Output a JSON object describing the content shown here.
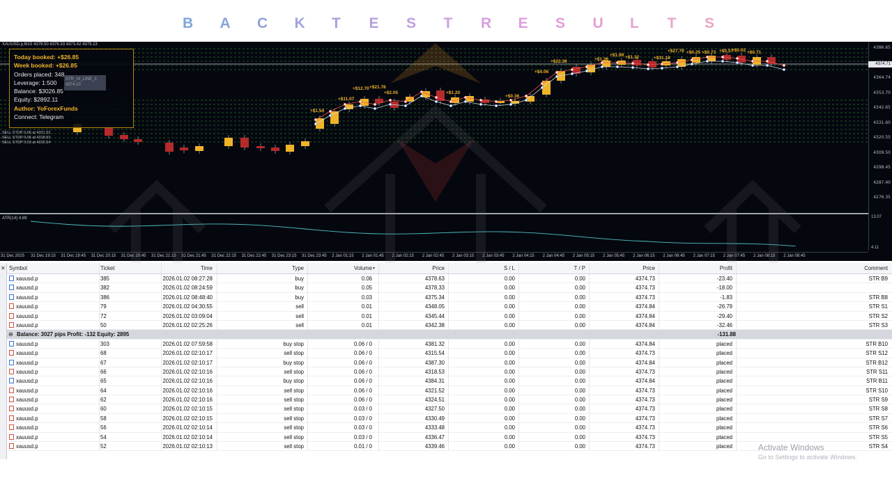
{
  "title": {
    "letters": [
      "B",
      "A",
      "C",
      "K",
      "T",
      "E",
      "S",
      "T",
      "R",
      "E",
      "S",
      "U",
      "L",
      "T",
      "S"
    ],
    "colors": [
      "#7fa6dc",
      "#86a3dc",
      "#93a2dd",
      "#a0a1de",
      "#a9a0df",
      "#b5a1df",
      "#c09fdf",
      "#cb9fdf",
      "#d49fde",
      "#dc9fdc",
      "#e29fd9",
      "#e59fd4",
      "#e7a2cf",
      "#e9a4ca",
      "#eba6c4"
    ]
  },
  "chart": {
    "top_line": "XAUUSD.p,M15  4379.50 4376.33 4373.42 4375.13",
    "info": {
      "today_booked": "Today booked: +$26.85",
      "week_booked": "Week booked: +$26.85",
      "orders_placed": "Orders placed: 348",
      "leverage": "Leverage: 1:500",
      "balance": "Balance: $3026.85",
      "equity": "Equity: $2892.11",
      "author": "Author: YoForexFunds",
      "connect": "Connect: Telegram"
    },
    "tooltip": [
      "STR_UI_LINE_1",
      "4374.10"
    ],
    "stop_labels": [
      "SELL STOP 0.06 at 4321.52",
      "SELL STOP 0.06 at 4318.53",
      "SELL STOP 0.03 at 4315.54"
    ],
    "price_ticks": [
      "4386.65",
      "4375.91",
      "4364.74",
      "4353.70",
      "4342.65",
      "4331.60",
      "4320.55",
      "4309.50",
      "4298.45",
      "4287.40",
      "4276.35"
    ],
    "current_price": "4374.71",
    "atr_label": "ATR(14) 4.89",
    "atr_ticks": [
      "13.07",
      "4.11"
    ],
    "time_ticks": [
      "31 Dec 2025",
      "31 Dec 19:15",
      "31 Dec 19:45",
      "31 Dec 20:15",
      "31 Dec 20:45",
      "31 Dec 21:15",
      "31 Dec 21:45",
      "31 Dec 22:15",
      "31 Dec 22:45",
      "31 Dec 23:15",
      "31 Dec 23:45",
      "2 Jan 01:15",
      "2 Jan 01:45",
      "2 Jan 02:15",
      "2 Jan 02:45",
      "2 Jan 03:15",
      "2 Jan 03:45",
      "2 Jan 04:15",
      "2 Jan 04:45",
      "2 Jan 05:15",
      "2 Jan 05:45",
      "2 Jan 06:15",
      "2 Jan 06:45",
      "2 Jan 07:15",
      "2 Jan 07:45",
      "2 Jan 08:15",
      "2 Jan 08:45"
    ],
    "trade_labels": [
      "+$1.54",
      "+$11.07",
      "+$12.70",
      "+$21.78",
      "+$2.05",
      "+$1.20",
      "+$0.36",
      "+$4.06",
      "+$22.38",
      "+$1.26",
      "+$1.99",
      "+$1.32",
      "+$31.18",
      "+$27.79",
      "+$0.25",
      "+$0.73",
      "+$0.57",
      "+$0.02",
      "+$0.71"
    ]
  },
  "table": {
    "columns": [
      "Symbol",
      "Ticket",
      "Time",
      "Type",
      "Volume",
      "Price",
      "S / L",
      "T / P",
      "Price",
      "Profit",
      "Comment"
    ],
    "positions": [
      {
        "symbol": "xauusd.p",
        "ticket": "385",
        "time": "2026.01.02 08:27:28",
        "type": "buy",
        "volume": "0.06",
        "price": "4378.63",
        "sl": "0.00",
        "tp": "0.00",
        "cur": "4374.73",
        "profit": "-23.40",
        "comment": "STR B9"
      },
      {
        "symbol": "xauusd.p",
        "ticket": "382",
        "time": "2026.01.02 08:24:59",
        "type": "buy",
        "volume": "0.05",
        "price": "4378.33",
        "sl": "0.00",
        "tp": "0.00",
        "cur": "4374.73",
        "profit": "-18.00",
        "comment": ""
      },
      {
        "symbol": "xauusd.p",
        "ticket": "386",
        "time": "2026.01.02 08:48:40",
        "type": "buy",
        "volume": "0.03",
        "price": "4375.34",
        "sl": "0.00",
        "tp": "0.00",
        "cur": "4374.73",
        "profit": "-1.83",
        "comment": "STR B8"
      },
      {
        "symbol": "xauusd.p",
        "ticket": "79",
        "time": "2026.01.02 04:30:55",
        "type": "sell",
        "volume": "0.01",
        "price": "4348.05",
        "sl": "0.00",
        "tp": "0.00",
        "cur": "4374.84",
        "profit": "-26.79",
        "comment": "STR S1"
      },
      {
        "symbol": "xauusd.p",
        "ticket": "72",
        "time": "2026.01.02 03:09:04",
        "type": "sell",
        "volume": "0.01",
        "price": "4345.44",
        "sl": "0.00",
        "tp": "0.00",
        "cur": "4374.84",
        "profit": "-29.40",
        "comment": "STR S2"
      },
      {
        "symbol": "xauusd.p",
        "ticket": "50",
        "time": "2026.01.02 02:25:26",
        "type": "sell",
        "volume": "0.01",
        "price": "4342.38",
        "sl": "0.00",
        "tp": "0.00",
        "cur": "4374.84",
        "profit": "-32.46",
        "comment": "STR S3"
      }
    ],
    "balance_row": {
      "text": "Balance: 3027 pips   Profit: -132   Equity: 2895",
      "profit": "-131.88"
    },
    "orders": [
      {
        "symbol": "xauusd.p",
        "ticket": "303",
        "time": "2026.01.02 07:59:58",
        "type": "buy stop",
        "volume": "0.06 / 0",
        "price": "4381.32",
        "sl": "0.00",
        "tp": "0.00",
        "cur": "4374.84",
        "profit": "placed",
        "comment": "STR B10"
      },
      {
        "symbol": "xauusd.p",
        "ticket": "68",
        "time": "2026.01.02 02:10:17",
        "type": "sell stop",
        "volume": "0.06 / 0",
        "price": "4315.54",
        "sl": "0.00",
        "tp": "0.00",
        "cur": "4374.73",
        "profit": "placed",
        "comment": "STR S12"
      },
      {
        "symbol": "xauusd.p",
        "ticket": "67",
        "time": "2026.01.02 02:10:17",
        "type": "buy stop",
        "volume": "0.06 / 0",
        "price": "4387.30",
        "sl": "0.00",
        "tp": "0.00",
        "cur": "4374.84",
        "profit": "placed",
        "comment": "STR B12"
      },
      {
        "symbol": "xauusd.p",
        "ticket": "66",
        "time": "2026.01.02 02:10:16",
        "type": "sell stop",
        "volume": "0.06 / 0",
        "price": "4318.53",
        "sl": "0.00",
        "tp": "0.00",
        "cur": "4374.73",
        "profit": "placed",
        "comment": "STR S11"
      },
      {
        "symbol": "xauusd.p",
        "ticket": "65",
        "time": "2026.01.02 02:10:16",
        "type": "buy stop",
        "volume": "0.06 / 0",
        "price": "4384.31",
        "sl": "0.00",
        "tp": "0.00",
        "cur": "4374.84",
        "profit": "placed",
        "comment": "STR B11"
      },
      {
        "symbol": "xauusd.p",
        "ticket": "64",
        "time": "2026.01.02 02:10:16",
        "type": "sell stop",
        "volume": "0.06 / 0",
        "price": "4321.52",
        "sl": "0.00",
        "tp": "0.00",
        "cur": "4374.73",
        "profit": "placed",
        "comment": "STR S10"
      },
      {
        "symbol": "xauusd.p",
        "ticket": "62",
        "time": "2026.01.02 02:10:16",
        "type": "sell stop",
        "volume": "0.06 / 0",
        "price": "4324.51",
        "sl": "0.00",
        "tp": "0.00",
        "cur": "4374.73",
        "profit": "placed",
        "comment": "STR S9"
      },
      {
        "symbol": "xauusd.p",
        "ticket": "60",
        "time": "2026.01.02 02:10:15",
        "type": "sell stop",
        "volume": "0.03 / 0",
        "price": "4327.50",
        "sl": "0.00",
        "tp": "0.00",
        "cur": "4374.73",
        "profit": "placed",
        "comment": "STR S8"
      },
      {
        "symbol": "xauusd.p",
        "ticket": "58",
        "time": "2026.01.02 02:10:15",
        "type": "sell stop",
        "volume": "0.03 / 0",
        "price": "4330.49",
        "sl": "0.00",
        "tp": "0.00",
        "cur": "4374.73",
        "profit": "placed",
        "comment": "STR S7"
      },
      {
        "symbol": "xauusd.p",
        "ticket": "56",
        "time": "2026.01.02 02:10:14",
        "type": "sell stop",
        "volume": "0.03 / 0",
        "price": "4333.48",
        "sl": "0.00",
        "tp": "0.00",
        "cur": "4374.73",
        "profit": "placed",
        "comment": "STR S6"
      },
      {
        "symbol": "xauusd.p",
        "ticket": "54",
        "time": "2026.01.02 02:10:14",
        "type": "sell stop",
        "volume": "0.03 / 0",
        "price": "4336.47",
        "sl": "0.00",
        "tp": "0.00",
        "cur": "4374.73",
        "profit": "placed",
        "comment": "STR S5"
      },
      {
        "symbol": "xauusd.p",
        "ticket": "52",
        "time": "2026.01.02 02:10:13",
        "type": "sell stop",
        "volume": "0.01 / 0",
        "price": "4339.46",
        "sl": "0.00",
        "tp": "0.00",
        "cur": "4374.73",
        "profit": "placed",
        "comment": "STR S4"
      }
    ]
  },
  "watermark": {
    "line1": "Activate Windows",
    "line2": "Go to Settings to activate Windows."
  },
  "colors": {
    "gold": "#f0b429",
    "bull": "#f0b429",
    "bear": "#b52a2a",
    "grid": "#39a832",
    "atr": "#4fc3c3",
    "buy_icon": "#3b6fd1",
    "sell_icon": "#d14b3b"
  }
}
